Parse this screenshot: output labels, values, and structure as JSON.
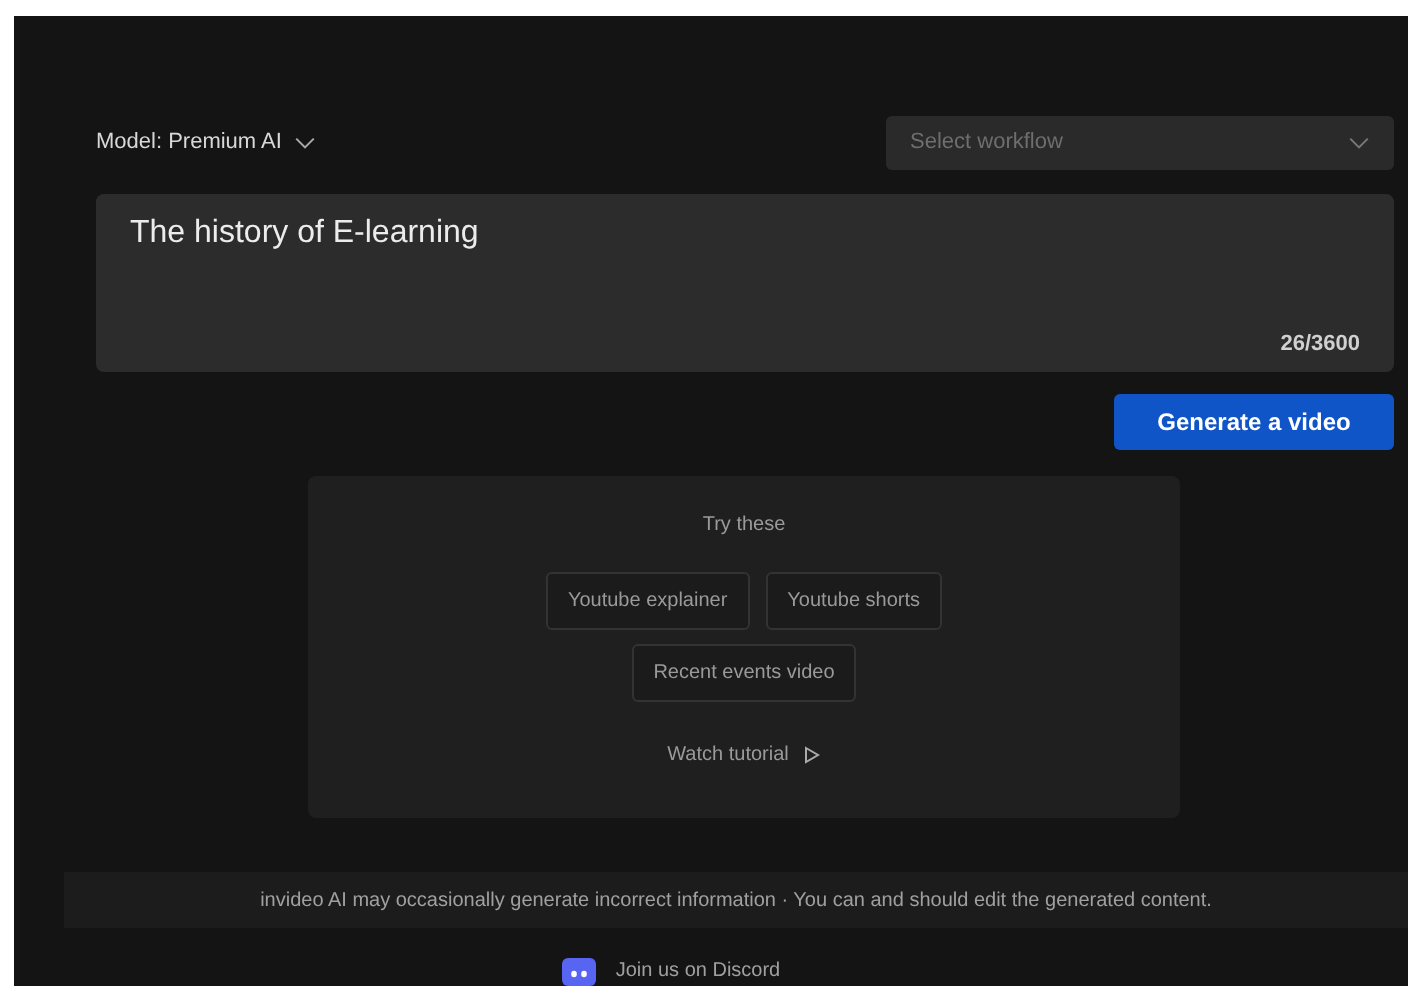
{
  "model_selector": {
    "label": "Model: Premium AI"
  },
  "workflow_select": {
    "placeholder": "Select workflow"
  },
  "prompt": {
    "value": "The history of E-learning",
    "counter": "26/3600"
  },
  "generate_button": {
    "label": "Generate a video"
  },
  "suggestions": {
    "title": "Try these",
    "items": [
      {
        "label": "Youtube explainer"
      },
      {
        "label": "Youtube shorts"
      },
      {
        "label": "Recent events video"
      }
    ],
    "tutorial_link": "Watch tutorial"
  },
  "disclaimer": "invideo AI may occasionally generate incorrect information · You can and should edit the generated content.",
  "discord_link": "Join us on Discord"
}
